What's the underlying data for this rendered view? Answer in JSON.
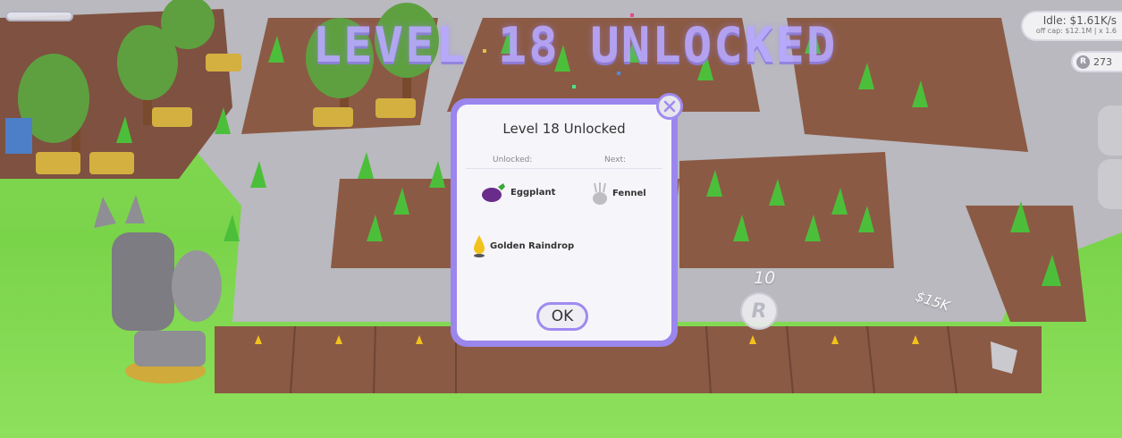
{
  "banner": {
    "text": "LEVEL 18 UNLOCKED"
  },
  "hud": {
    "idle_rate": "Idle: $1.61K/s",
    "offline_info": "off cap: $12.1M | x 1.6",
    "coin_value": "273",
    "coin_symbol": "R"
  },
  "modal": {
    "title": "Level 18 Unlocked",
    "unlocked_header": "Unlocked:",
    "next_header": "Next:",
    "unlocked_items": [
      "Eggplant",
      "Golden Raindrop"
    ],
    "next_items": [
      "Fennel"
    ],
    "ok_label": "OK"
  },
  "field": {
    "floating_number": "10",
    "money_popup": "$15K",
    "coin_letter": "R"
  },
  "colors": {
    "accent_purple": "#9f8bf0",
    "banner_purple": "#b7a8ff",
    "grass": "#7ad44a",
    "path_stone": "#b5b5bb",
    "soil": "#8a5a45"
  }
}
